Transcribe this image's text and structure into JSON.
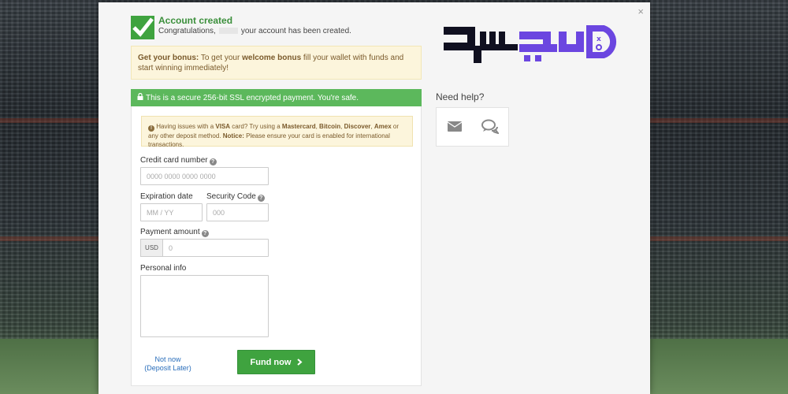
{
  "account": {
    "title": "Account created",
    "message_before": "Congratulations,",
    "message_after": "your account has been created."
  },
  "bonus": {
    "lead": "Get your bonus:",
    "text_1": "To get your",
    "highlight": "welcome bonus",
    "text_2": "fill your wallet with funds and start winning immediately!"
  },
  "secure": {
    "text": "This is a secure 256-bit SSL encrypted payment. You're safe."
  },
  "warning": {
    "t1": "Having issues with a",
    "visa": "VISA",
    "t2": "card? Try using a",
    "mastercard": "Mastercard",
    "bitcoin": "Bitcoin",
    "discover": "Discover",
    "amex": "Amex",
    "t3": "or any other deposit method.",
    "notice": "Notice:",
    "t4": "Please ensure your card is enabled for international transactions."
  },
  "form": {
    "card_label": "Credit card number",
    "card_placeholder": "0000 0000 0000 0000",
    "exp_label": "Expiration date",
    "exp_placeholder": "MM / YY",
    "cvc_label": "Security Code",
    "cvc_placeholder": "000",
    "amount_label": "Payment amount",
    "currency": "USD",
    "amount_placeholder": "0",
    "personal_label": "Personal info"
  },
  "actions": {
    "not_now_1": "Not now",
    "not_now_2": "(Deposit Later)",
    "fund_label": "Fund now"
  },
  "help": {
    "title": "Need help?"
  },
  "colors": {
    "green": "#3fa33f",
    "secure_green": "#5cb85c",
    "logo": "#6b46e0"
  },
  "icons": [
    "check-icon",
    "close-icon",
    "lock-icon",
    "info-icon",
    "question-icon",
    "chevron-right-icon",
    "mail-icon",
    "chat-icon"
  ]
}
